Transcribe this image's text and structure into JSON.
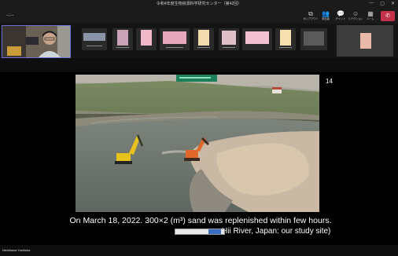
{
  "window": {
    "title": "令和4年度生物資源科学研究センター（第42回）",
    "controls": [
      "—",
      "▢",
      "✕"
    ]
  },
  "toolbar": {
    "timer": "--:--",
    "actions": [
      {
        "icon": "people-icon",
        "glyph": "👥",
        "label": "参加者",
        "active": true
      },
      {
        "icon": "chat-icon",
        "glyph": "💬",
        "label": "チャット",
        "active": false
      },
      {
        "icon": "reaction-icon",
        "glyph": "☺",
        "label": "リアクション",
        "active": false
      },
      {
        "icon": "rooms-icon",
        "glyph": "▦",
        "label": "ルーム",
        "active": false
      },
      {
        "icon": "more-icon",
        "glyph": "⋯",
        "label": "その他",
        "active": false
      }
    ],
    "popout_label": "ポップアウト",
    "leave_icon": "phone-hangup-icon"
  },
  "participants": {
    "self_name": "",
    "thumbnails": [
      {
        "color": "#8a94a8"
      },
      {
        "color": "#c9a2b6"
      },
      {
        "color": "#f0b8c8"
      },
      {
        "color": "#e6a7bc"
      },
      {
        "color": "#f3dcb0"
      },
      {
        "color": "#e0c0c8"
      },
      {
        "color": "#f0c0d0"
      },
      {
        "color": "#f6e0b0"
      },
      {
        "color": "#5a5a5a"
      },
      {
        "color": "#e8b8a8"
      }
    ]
  },
  "slide": {
    "number": "14",
    "caption_line1": "On March 18, 2022. 300×2 (m³) sand was replenished within few hours.",
    "caption_line2": "Hii River, Japan: our study site)"
  },
  "presenter": {
    "name": "Nishikawa Yoshioka"
  },
  "colors": {
    "accent": "#6b6fd6",
    "leave": "#c4314b",
    "excavator_left": "#e7c21d",
    "excavator_right": "#e0662a"
  }
}
